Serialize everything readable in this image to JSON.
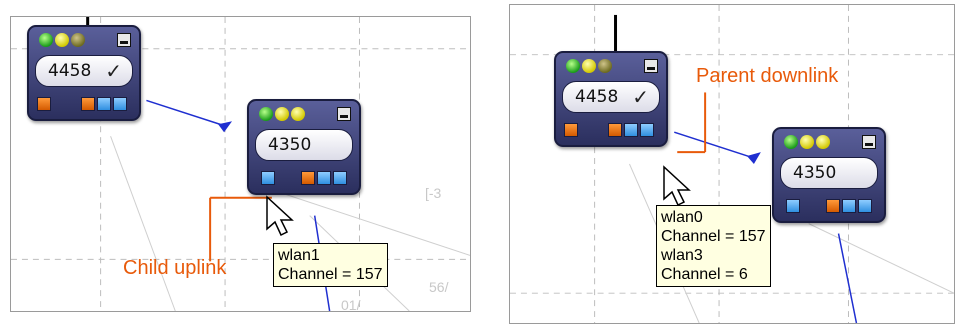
{
  "left_panel": {
    "node_a": {
      "id": "4458"
    },
    "node_b": {
      "id": "4350"
    },
    "tooltip": {
      "line1": "wlan1",
      "line2": "Channel = 157"
    },
    "annotation": "Child uplink",
    "faint_labels": {
      "a": "[-3",
      "b": "56/",
      "c": "01/"
    }
  },
  "right_panel": {
    "node_a": {
      "id": "4458"
    },
    "node_b": {
      "id": "4350"
    },
    "tooltip": {
      "line1": "wlan0",
      "line2": "Channel = 157",
      "line3": "wlan3",
      "line4": "Channel = 6"
    },
    "annotation": "Parent downlink"
  },
  "icons": [
    "led-green-icon",
    "led-yellow-icon",
    "led-olive-icon",
    "minimize-icon",
    "check-icon",
    "port-icon",
    "cursor-icon"
  ],
  "colors": {
    "annotation": "#e85a0a",
    "link": "#1f2fd0",
    "node_bg": "#3f4478",
    "tooltip_bg": "#ffffe1"
  }
}
